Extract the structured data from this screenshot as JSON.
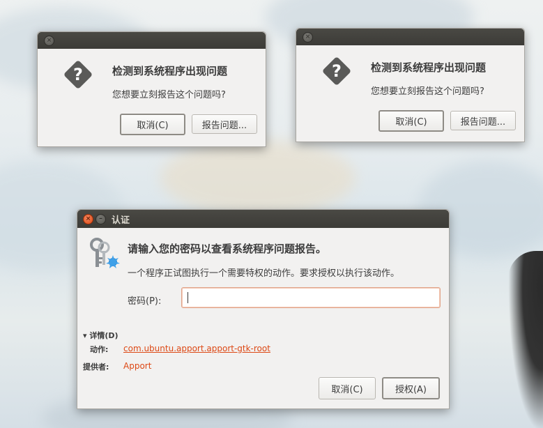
{
  "crash_dialogs": [
    {
      "close_glyph": "×",
      "heading": "检测到系统程序出现问题",
      "question": "您想要立刻报告这个问题吗?",
      "cancel_label": "取消(C)",
      "report_label": "报告问题..."
    },
    {
      "close_glyph": "×",
      "heading": "检测到系统程序出现问题",
      "question": "您想要立刻报告这个问题吗?",
      "cancel_label": "取消(C)",
      "report_label": "报告问题..."
    }
  ],
  "auth_dialog": {
    "title": "认证",
    "close_glyph": "×",
    "minimize_glyph": "–",
    "heading": "请输入您的密码以查看系统程序问题报告。",
    "description": "一个程序正试图执行一个需要特权的动作。要求授权以执行该动作。",
    "password_label": "密码(P):",
    "password_value": "",
    "details_toggle": "▾ 详情(D)",
    "action_label": "动作:",
    "action_value": "com.ubuntu.apport.apport-gtk-root",
    "vendor_label": "提供者:",
    "vendor_value": "Apport",
    "cancel_label": "取消(C)",
    "authorize_label": "授权(A)"
  },
  "icons": {
    "question": "question-diamond-icon",
    "keys": "keys-icon"
  },
  "colors": {
    "titlebar": "#3c3b37",
    "accent": "#dd4814",
    "dialog_bg": "#f2f1f0"
  }
}
